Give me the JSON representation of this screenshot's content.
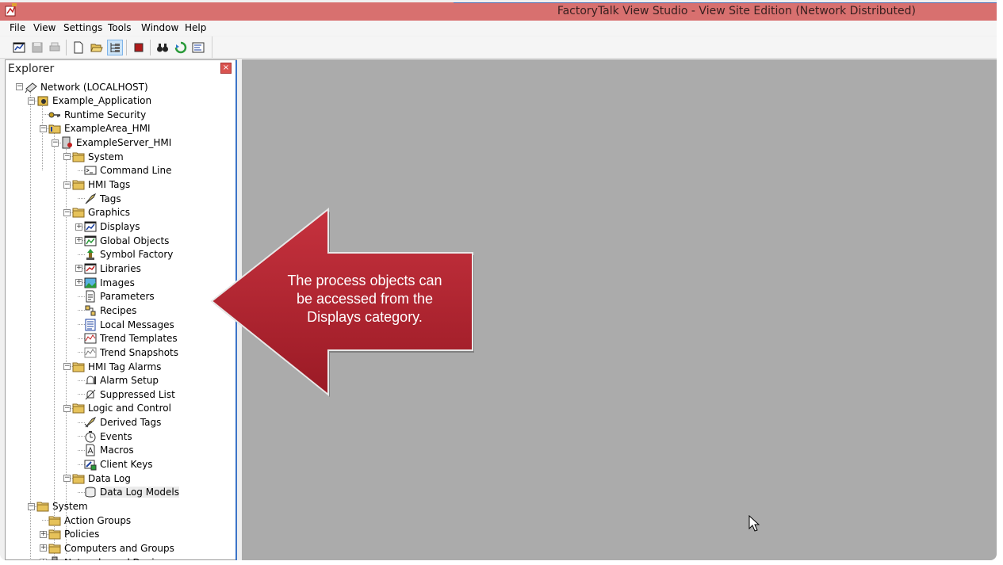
{
  "window": {
    "title": "FactoryTalk View Studio - View Site Edition (Network Distributed)"
  },
  "menu": [
    "File",
    "View",
    "Settings",
    "Tools",
    "Window",
    "Help"
  ],
  "toolbar": {
    "buttons": [
      "new-display-icon",
      "save-icon",
      "print-icon",
      "new-file-icon",
      "open-folder-icon",
      "explorer-tree-icon",
      "stop-icon",
      "binoculars-icon",
      "refresh-icon",
      "diagnostics-icon"
    ]
  },
  "explorer": {
    "title": "Explorer",
    "close_symbol": "×",
    "tree": [
      {
        "label": "Network (LOCALHOST)",
        "icon": "network-icon"
      },
      {
        "label": "Example_Application",
        "icon": "application-icon"
      },
      {
        "label": "Runtime Security",
        "icon": "key-icon"
      },
      {
        "label": "ExampleArea_HMI",
        "icon": "area-folder-icon"
      },
      {
        "label": "ExampleServer_HMI",
        "icon": "server-icon"
      },
      {
        "label": "System",
        "icon": "folder-icon"
      },
      {
        "label": "Command Line",
        "icon": "command-line-icon"
      },
      {
        "label": "HMI Tags",
        "icon": "folder-icon"
      },
      {
        "label": "Tags",
        "icon": "tags-icon"
      },
      {
        "label": "Graphics",
        "icon": "folder-icon"
      },
      {
        "label": "Displays",
        "icon": "displays-icon"
      },
      {
        "label": "Global Objects",
        "icon": "global-objects-icon"
      },
      {
        "label": "Symbol Factory",
        "icon": "symbol-factory-icon"
      },
      {
        "label": "Libraries",
        "icon": "libraries-icon"
      },
      {
        "label": "Images",
        "icon": "images-icon"
      },
      {
        "label": "Parameters",
        "icon": "parameters-icon"
      },
      {
        "label": "Recipes",
        "icon": "recipes-icon"
      },
      {
        "label": "Local Messages",
        "icon": "local-messages-icon"
      },
      {
        "label": "Trend Templates",
        "icon": "trend-templates-icon"
      },
      {
        "label": "Trend Snapshots",
        "icon": "trend-snapshots-icon"
      },
      {
        "label": "HMI Tag Alarms",
        "icon": "folder-icon"
      },
      {
        "label": "Alarm Setup",
        "icon": "alarm-setup-icon"
      },
      {
        "label": "Suppressed List",
        "icon": "suppressed-list-icon"
      },
      {
        "label": "Logic and Control",
        "icon": "folder-icon"
      },
      {
        "label": "Derived Tags",
        "icon": "derived-tags-icon"
      },
      {
        "label": "Events",
        "icon": "events-icon"
      },
      {
        "label": "Macros",
        "icon": "macros-icon"
      },
      {
        "label": "Client Keys",
        "icon": "client-keys-icon"
      },
      {
        "label": "Data Log",
        "icon": "folder-icon"
      },
      {
        "label": "Data Log Models",
        "icon": "data-log-models-icon"
      },
      {
        "label": "System",
        "icon": "folder-icon"
      },
      {
        "label": "Action Groups",
        "icon": "folder-icon"
      },
      {
        "label": "Policies",
        "icon": "folder-icon"
      },
      {
        "label": "Computers and Groups",
        "icon": "folder-icon"
      },
      {
        "label": "Networks and Devices",
        "icon": "network-devices-icon"
      }
    ]
  },
  "callout": {
    "line1": "The process objects can",
    "line2": "be accessed from the",
    "line3": "Displays category.",
    "color": "#b8222f"
  },
  "colors": {
    "titlebar": "#d8706f",
    "workspace": "#ababab",
    "explorer_accent": "#3c74c8"
  }
}
